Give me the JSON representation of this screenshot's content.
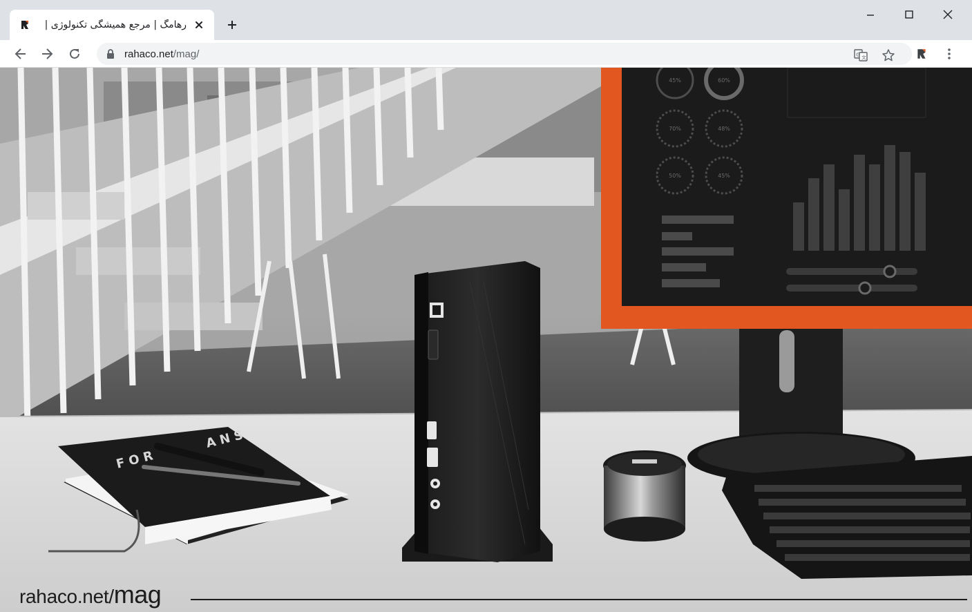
{
  "browser": {
    "tab": {
      "title": "رهامگ | مرجع همیشگی تکنولوژی |",
      "favicon": "rahaco-logo-icon"
    },
    "new_tab_label": "+",
    "window_controls": [
      "minimize-icon",
      "maximize-icon",
      "close-icon"
    ]
  },
  "toolbar": {
    "url_host": "rahaco.net",
    "url_path": "/mag/",
    "icons": [
      "back-arrow-icon",
      "forward-arrow-icon",
      "reload-icon",
      "lock-icon",
      "translate-icon",
      "star-icon",
      "extension-icon",
      "menu-dots-icon"
    ]
  },
  "hero": {
    "caption_host": "rahaco.net/",
    "caption_slug": "mag",
    "monitor_labels": [
      "45%",
      "60%",
      "70%",
      "48%",
      "50%",
      "45%"
    ]
  },
  "colors": {
    "monitor_bezel": "#e2561f",
    "tabstrip": "#dee1e6",
    "omnibox": "#f1f3f4"
  }
}
